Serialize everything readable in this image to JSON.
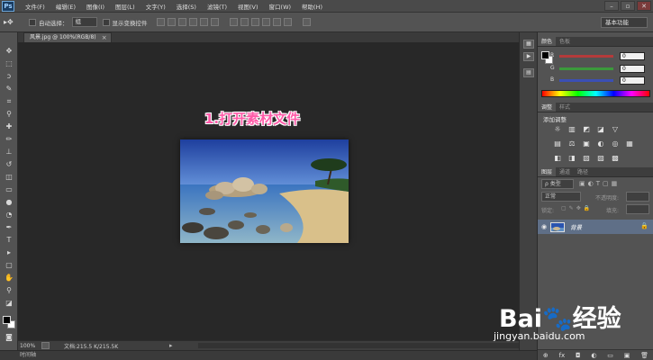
{
  "app": {
    "logo_text": "Ps",
    "menu": [
      "文件(F)",
      "编辑(E)",
      "图像(I)",
      "图层(L)",
      "文字(Y)",
      "选择(S)",
      "滤镜(T)",
      "视图(V)",
      "窗口(W)",
      "帮助(H)"
    ],
    "window_controls": [
      "–",
      "▫",
      "✕"
    ]
  },
  "options_bar": {
    "auto_select_label": "自动选择：",
    "auto_select_value": "组",
    "show_transform_label": "显示变换控件",
    "workspace": "基本功能"
  },
  "document": {
    "tab_title": "风景.jpg @ 100%(RGB/8)",
    "tab_close": "×",
    "annotation": "1.打开素材文件"
  },
  "status": {
    "zoom": "100%",
    "doc_info": "文档:215.5 K/215.5K",
    "timeline_label": "时间轴"
  },
  "color_panel": {
    "tabs": [
      "颜色",
      "色板"
    ],
    "rows": [
      {
        "letter": "R",
        "value": "0",
        "color": "#b43b3b"
      },
      {
        "letter": "G",
        "value": "0",
        "color": "#3b9a3b"
      },
      {
        "letter": "B",
        "value": "0",
        "color": "#3b4fb4"
      }
    ]
  },
  "adjust_panel": {
    "tabs": [
      "调整",
      "样式"
    ],
    "title": "添加调整",
    "icons": [
      "☼",
      "▥",
      "◩",
      "◪",
      "▽",
      "",
      "▤",
      "⚖",
      "▣",
      "◐",
      "◎",
      "▦",
      "◧",
      "◨",
      "▧",
      "▨",
      "▩",
      ""
    ]
  },
  "layers_panel": {
    "tabs": [
      "图层",
      "通道",
      "路径"
    ],
    "filter_label": "ρ 类型",
    "blend_mode": "正常",
    "opacity_label": "不透明度:",
    "lock_label": "锁定:",
    "fill_label": "填充:",
    "layer_name": "背景",
    "eye": "◉",
    "lock_icon": "🔒",
    "bottom_icons": [
      "⊕",
      "fx",
      "◘",
      "◐",
      "▭",
      "▣",
      "🗑"
    ]
  },
  "watermark": {
    "brand": "Bai🐾经验",
    "url": "jingyan.baidu.com"
  },
  "colors": {
    "annotation_pink": "#ff5aa8",
    "layer_selected": "#5f6f87"
  }
}
